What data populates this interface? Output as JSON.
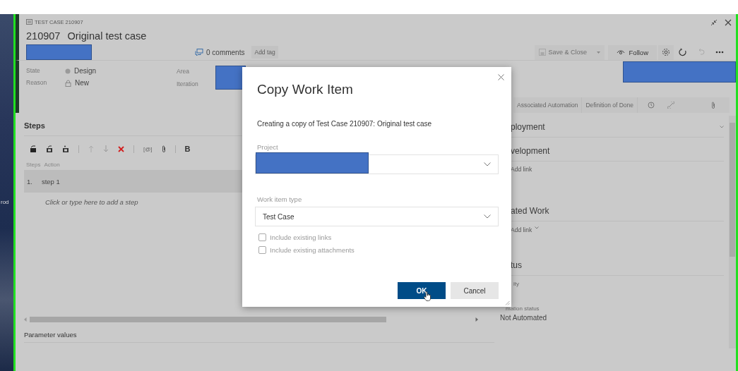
{
  "desktop": {
    "edge_text": "rod"
  },
  "work_item": {
    "type_label": "TEST CASE 210907",
    "id": "210907",
    "title": "Original test case",
    "comments": "0 comments",
    "add_tag": "Add tag",
    "toolbar": {
      "save": "Save & Close",
      "save_disabled": true,
      "follow": "Follow"
    },
    "fields": [
      {
        "label": "State",
        "value": "Design",
        "kind": "dot"
      },
      {
        "label": "Reason",
        "value": "New",
        "kind": "lock"
      }
    ],
    "fields_right": [
      {
        "label": "Area"
      },
      {
        "label": "Iteration"
      }
    ],
    "tabs": [
      {
        "label": "Associated Automation",
        "selected": false
      },
      {
        "label": "Definition of Done",
        "selected": false
      }
    ],
    "steps": {
      "title": "Steps",
      "insert_param": "[@]",
      "bold": "B",
      "columns": [
        "Steps",
        "Action"
      ],
      "rows": [
        {
          "number": "1.",
          "action": "step 1"
        }
      ],
      "add_hint": "Click or type here to add a step",
      "parameter_values": "Parameter values"
    },
    "side": [
      {
        "title": "ployment",
        "kind": "collapsible"
      },
      {
        "title": "velopment",
        "link": "Add link",
        "kind": "links"
      },
      {
        "title": "ated Work",
        "link": "Add link",
        "kind": "links_menu"
      },
      {
        "title": "tus",
        "kind": "status",
        "fields": [
          {
            "label": "ity"
          },
          {
            "label": "mation status",
            "value": "Not Automated"
          }
        ]
      }
    ]
  },
  "dialog": {
    "title": "Copy Work Item",
    "description": "Creating a copy of Test Case 210907: Original test case",
    "project_label": "Project",
    "type_label": "Work item type",
    "type_value": "Test Case",
    "options": [
      {
        "label": "Include existing links",
        "checked": false
      },
      {
        "label": "Include existing attachments",
        "checked": false
      }
    ],
    "ok": "OK",
    "cancel": "Cancel"
  }
}
